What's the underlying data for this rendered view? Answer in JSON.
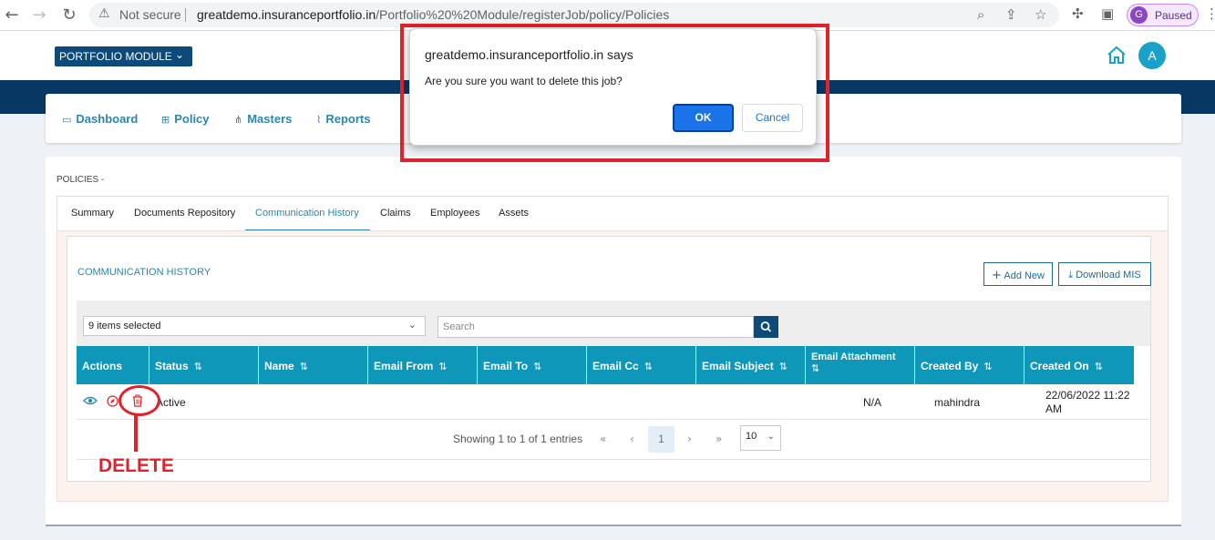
{
  "browser": {
    "back_icon": "arrow-left-icon",
    "forward_icon": "arrow-right-icon",
    "reload_icon": "reload-icon",
    "security_label": "Not secure",
    "url_host": "greatdemo.insuranceportfolio.in",
    "url_path": "/Portfolio%20%20Module/registerJob/policy/Policies",
    "profile_initial": "G",
    "profile_status": "Paused"
  },
  "header": {
    "module_label": "PORTFOLIO MODULE",
    "avatar_initial": "A"
  },
  "nav": {
    "items": [
      {
        "label": "Dashboard",
        "icon": "monitor-icon"
      },
      {
        "label": "Policy",
        "icon": "grid-icon"
      },
      {
        "label": "Masters",
        "icon": "sitemap-icon"
      },
      {
        "label": "Reports",
        "icon": "chart-icon"
      }
    ]
  },
  "page": {
    "title": "POLICIES -",
    "tabs": [
      "Summary",
      "Documents Repository",
      "Communication History",
      "Claims",
      "Employees",
      "Assets"
    ],
    "active_tab": "Communication History",
    "section_title": "COMMUNICATION HISTORY",
    "add_new_label": "Add New",
    "download_label": "Download MIS"
  },
  "filter": {
    "selected_label": "9 items selected",
    "search_placeholder": "Search"
  },
  "table": {
    "columns": [
      "Actions",
      "Status",
      "Name",
      "Email From",
      "Email To",
      "Email Cc",
      "Email Subject",
      "Email Attachment",
      "Created By",
      "Created On"
    ],
    "rows": [
      {
        "status": "Active",
        "name": "",
        "email_from": "",
        "email_to": "",
        "email_cc": "",
        "email_subject": "",
        "email_attachment": "N/A",
        "created_by": "mahindra",
        "created_on_line1": "22/06/2022 11:22",
        "created_on_line2": "AM"
      }
    ]
  },
  "pagination": {
    "summary": "Showing 1 to 1 of 1 entries",
    "current_page": "1",
    "page_size": "10"
  },
  "dialog": {
    "title": "greatdemo.insuranceportfolio.in says",
    "message": "Are you sure you want to delete this job?",
    "ok_label": "OK",
    "cancel_label": "Cancel"
  },
  "annotation": {
    "label": "DELETE",
    "color": "#e0232b"
  },
  "colors": {
    "brand_navy": "#073763",
    "accent_teal": "#0e97b9",
    "link_blue": "#2b86b0",
    "dialog_ok": "#1a73e8"
  }
}
